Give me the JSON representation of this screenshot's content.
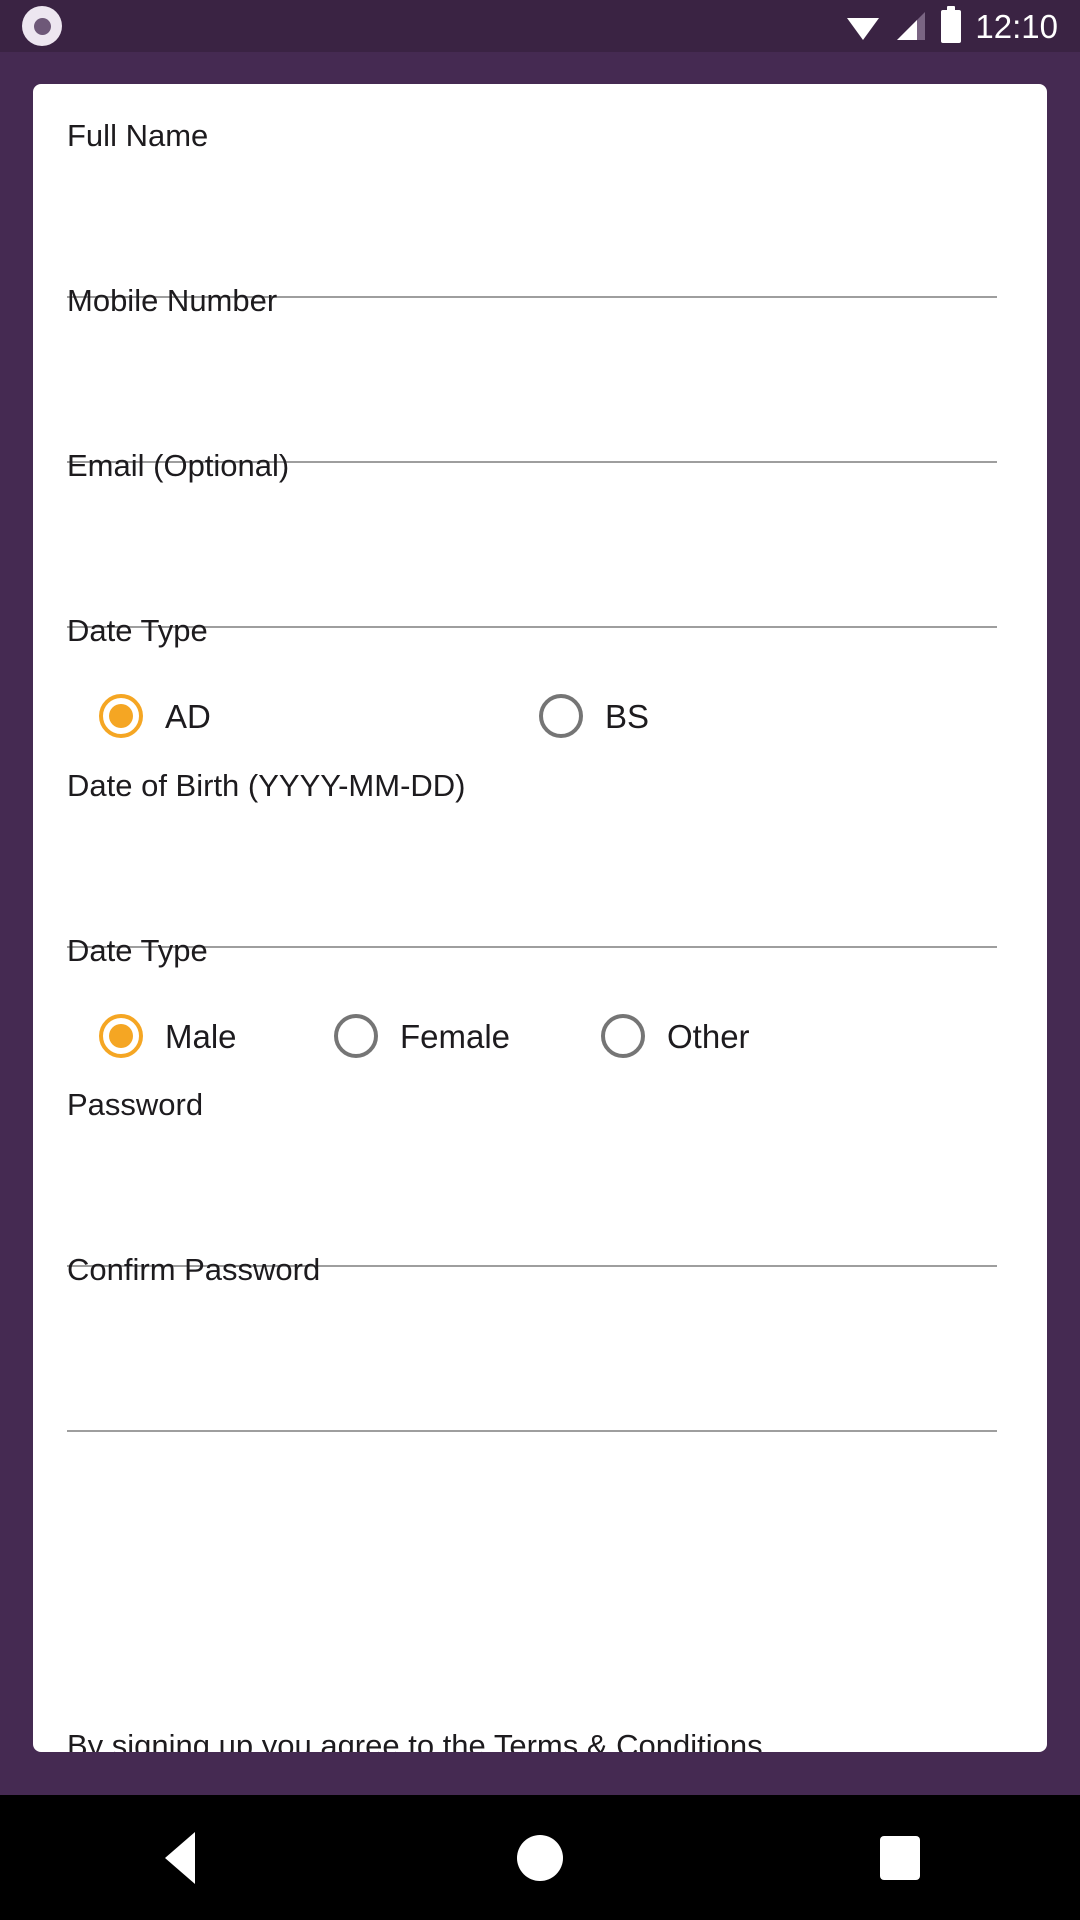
{
  "status_bar": {
    "background_color": "#3A2343",
    "left_icon": "target-circle-icon",
    "icons": [
      "wifi-icon",
      "signal-icon",
      "battery-icon"
    ],
    "clock": "12:10"
  },
  "theme": {
    "background_color": "#452A52",
    "card_color": "#FFFFFF",
    "accent_color": "#F5A623",
    "underline_color": "#9E9E9E",
    "text_color": "#1D1B1E"
  },
  "form": {
    "fields": [
      {
        "label": "Full Name",
        "value": "",
        "placeholder": ""
      },
      {
        "label": "Mobile Number",
        "value": "",
        "placeholder": ""
      },
      {
        "label": "Email (Optional)",
        "value": "",
        "placeholder": ""
      }
    ],
    "date_type": {
      "label": "Date Type",
      "options": [
        {
          "label": "AD",
          "selected": true
        },
        {
          "label": "BS",
          "selected": false
        }
      ]
    },
    "dob": {
      "label": "Date of Birth (YYYY-MM-DD)",
      "value": "",
      "placeholder": ""
    },
    "gender": {
      "label": "Date Type",
      "options": [
        {
          "label": "Male",
          "selected": true
        },
        {
          "label": "Female",
          "selected": false
        },
        {
          "label": "Other",
          "selected": false
        }
      ]
    },
    "password": {
      "label": "Password",
      "value": "",
      "placeholder": ""
    },
    "confirm_password": {
      "label": "Confirm Password",
      "value": "",
      "placeholder": ""
    },
    "terms": "By signing up you agree to the Terms & Conditions"
  },
  "nav_bar": {
    "background_color": "#000000",
    "buttons": [
      {
        "name": "back",
        "icon": "back-triangle-icon"
      },
      {
        "name": "home",
        "icon": "home-circle-icon"
      },
      {
        "name": "recents",
        "icon": "recents-square-icon"
      }
    ]
  }
}
